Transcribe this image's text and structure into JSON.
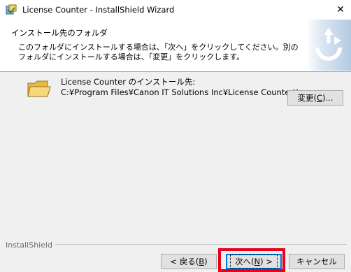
{
  "window": {
    "title": "License Counter - InstallShield Wizard",
    "close_glyph": "✕",
    "icon": "installer-icon"
  },
  "header": {
    "title": "インストール先のフォルダ",
    "description": "このフォルダにインストールする場合は、「次へ」をクリックしてください。別のフォルダにインストールする場合は、「変更」をクリックします。",
    "logo_icon": "installshield-logo-icon"
  },
  "destination": {
    "label": "License Counter のインストール先:",
    "path": "C:¥Program Files¥Canon IT Solutions Inc¥License Counter¥",
    "folder_icon": "folder-icon"
  },
  "buttons": {
    "change_text": "変更(",
    "change_key": "C",
    "change_suffix": ")...",
    "back_text": "< 戻る(",
    "back_key": "B",
    "back_suffix": ")",
    "next_text": "次へ(",
    "next_key": "N",
    "next_suffix": ") >",
    "cancel": "キャンセル"
  },
  "footer": {
    "brand": "InstallShield"
  },
  "colors": {
    "highlight": "#e8001c",
    "accent": "#0078d7"
  }
}
